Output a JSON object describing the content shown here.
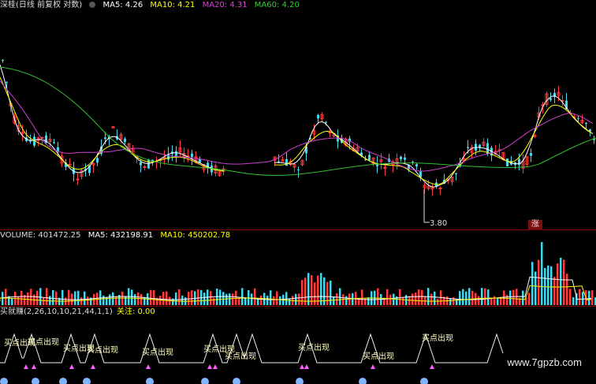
{
  "header": {
    "title": "深桂(日线 前复权 对数)",
    "ma5": "MA5: 4.26",
    "ma10": "MA10: 4.21",
    "ma20": "MA20: 4.31",
    "ma60": "MA60: 4.20"
  },
  "main": {
    "low_label": "3.80",
    "zhang_label": "涨"
  },
  "volume": {
    "volume": "VOLUME: 401472.25",
    "ma5": "MA5: 432198.91",
    "ma10": "MA10: 450202.78"
  },
  "indicator": {
    "name": "买就赚(2,26,10,10,21,44,1,1)",
    "focus": "关注: 0.00",
    "signal_label": "买点出现"
  },
  "watermark": "www.7gpzb.com",
  "colors": {
    "up": "#ff3b3b",
    "down": "#44d7ee",
    "ma5": "#ffffff",
    "ma10": "#ffff00",
    "ma20": "#d040d0",
    "ma60": "#30c030"
  }
}
